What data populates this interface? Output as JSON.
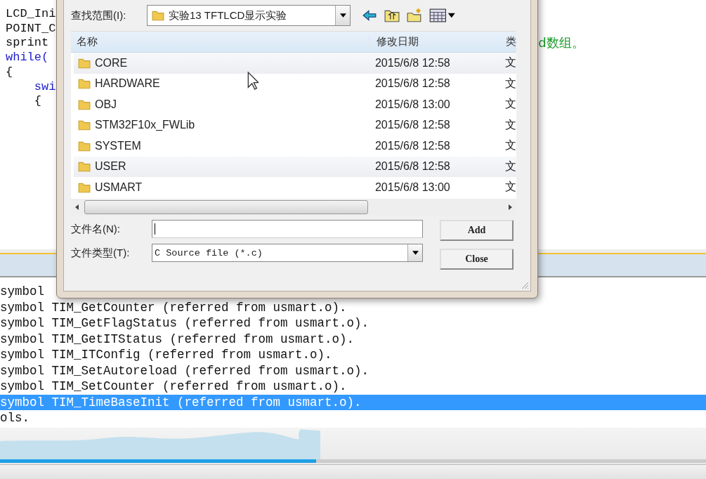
{
  "editor": {
    "code_lines": [
      {
        "text": "LCD_Ini",
        "kind": "code"
      },
      {
        "text": "POINT_C",
        "kind": "code"
      },
      {
        "text": "sprint",
        "kind": "code",
        "comment": "d数组。"
      },
      {
        "text": "while(",
        "kind": "keyword"
      },
      {
        "text": "{",
        "kind": "code"
      },
      {
        "text": "    swi",
        "kind": "keyword"
      },
      {
        "text": "    {",
        "kind": "code"
      }
    ]
  },
  "dialog": {
    "look_in": {
      "label": "查找范围(I):",
      "value": "实验13 TFTLCD显示实验"
    },
    "columns": [
      "名称",
      "修改日期",
      "类"
    ],
    "rows": [
      {
        "name": "CORE",
        "date": "2015/6/8 12:58",
        "type": "文",
        "highlighted": true
      },
      {
        "name": "HARDWARE",
        "date": "2015/6/8 12:58",
        "type": "文",
        "highlighted": false
      },
      {
        "name": "OBJ",
        "date": "2015/6/8 13:00",
        "type": "文",
        "highlighted": false
      },
      {
        "name": "STM32F10x_FWLib",
        "date": "2015/6/8 12:58",
        "type": "文",
        "highlighted": false
      },
      {
        "name": "SYSTEM",
        "date": "2015/6/8 12:58",
        "type": "文",
        "highlighted": false
      },
      {
        "name": "USER",
        "date": "2015/6/8 12:58",
        "type": "文",
        "highlighted": true
      },
      {
        "name": "USMART",
        "date": "2015/6/8 13:00",
        "type": "文",
        "highlighted": false
      }
    ],
    "file_name": {
      "label": "文件名(N):"
    },
    "file_type": {
      "label": "文件类型(T):",
      "value": "C Source file (*.c)"
    },
    "buttons": [
      "Add",
      "Close"
    ]
  },
  "output": {
    "lines": [
      {
        "text": "symbol",
        "selected": false
      },
      {
        "text": "symbol TIM_GetCounter (referred from usmart.o).",
        "selected": false
      },
      {
        "text": "symbol TIM_GetFlagStatus (referred from usmart.o).",
        "selected": false
      },
      {
        "text": "symbol TIM_GetITStatus (referred from usmart.o).",
        "selected": false
      },
      {
        "text": "symbol TIM_ITConfig (referred from usmart.o).",
        "selected": false
      },
      {
        "text": "symbol TIM_SetAutoreload (referred from usmart.o).",
        "selected": false
      },
      {
        "text": "symbol TIM_SetCounter (referred from usmart.o).",
        "selected": false
      },
      {
        "text": "symbol TIM_TimeBaseInit (referred from usmart.o).",
        "selected": true
      },
      {
        "text": "ols.",
        "selected": false
      }
    ]
  },
  "player": {
    "progress": {
      "level": 0.448
    }
  }
}
